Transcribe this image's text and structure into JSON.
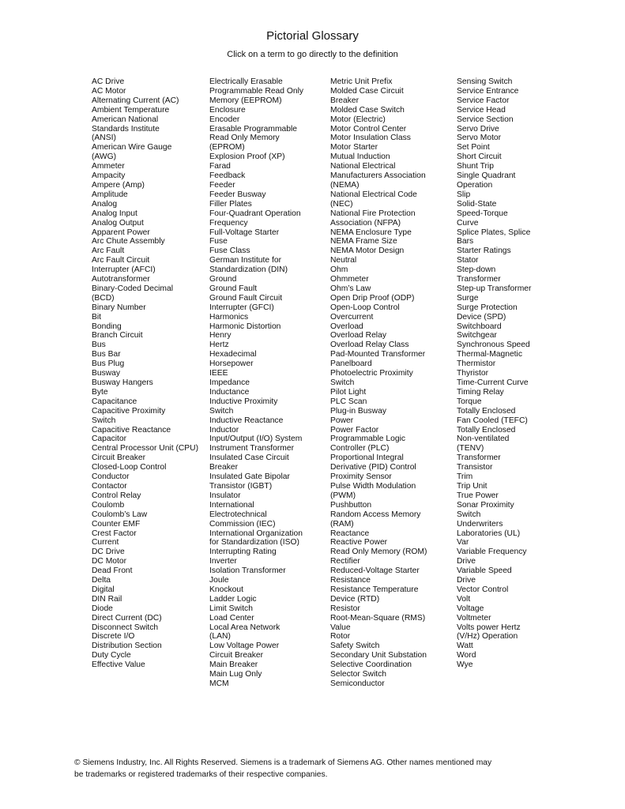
{
  "header": {
    "title": "Pictorial Glossary",
    "subtitle": "Click on a term to go directly to the definition"
  },
  "columns": [
    [
      "AC Drive",
      "AC Motor",
      "Alternating Current (AC)",
      "Ambient Temperature",
      "American National",
      "Standards Institute",
      "(ANSI)",
      "American Wire Gauge",
      "(AWG)",
      "Ammeter",
      "Ampacity",
      "Ampere (Amp)",
      "Amplitude",
      "Analog",
      "Analog Input",
      "Analog Output",
      "Apparent Power",
      "Arc Chute Assembly",
      "Arc Fault",
      "Arc Fault Circuit",
      "Interrupter (AFCI)",
      "Autotransformer",
      "Binary-Coded Decimal",
      "(BCD)",
      "Binary Number",
      "Bit",
      "Bonding",
      "Branch Circuit",
      "Bus",
      "Bus Bar",
      "Bus Plug",
      "Busway",
      "Busway Hangers",
      "Byte",
      "Capacitance",
      "Capacitive Proximity",
      "Switch",
      "Capacitive Reactance",
      "Capacitor",
      "Central Processor Unit (CPU)",
      "Circuit Breaker",
      "Closed-Loop Control",
      "Conductor",
      "Contactor",
      "Control Relay",
      "Coulomb",
      "Coulomb’s Law",
      "Counter EMF",
      "Crest Factor",
      "Current",
      "DC Drive",
      "DC Motor",
      "Dead Front",
      "Delta",
      "Digital",
      "DIN Rail",
      "Diode",
      "Direct Current (DC)",
      "Disconnect Switch",
      "Discrete I/O",
      "Distribution Section",
      "Duty Cycle",
      "Effective Value"
    ],
    [
      "Electrically Erasable",
      "Programmable Read Only",
      "Memory (EEPROM)",
      "Enclosure",
      "Encoder",
      "Erasable Programmable",
      "Read Only Memory",
      "(EPROM)",
      "Explosion Proof (XP)",
      "Farad",
      "Feedback",
      "Feeder",
      "Feeder Busway",
      "Filler Plates",
      "Four-Quadrant Operation",
      "Frequency",
      "Full-Voltage Starter",
      "Fuse",
      "Fuse Class",
      "German Institute for",
      "Standardization (DIN)",
      "Ground",
      "Ground Fault",
      "Ground Fault Circuit",
      "Interrupter (GFCI)",
      "Harmonics",
      "Harmonic Distortion",
      "Henry",
      "Hertz",
      "Hexadecimal",
      "Horsepower",
      "IEEE",
      "Impedance",
      "Inductance",
      "Inductive Proximity",
      "Switch",
      "Inductive Reactance",
      "Inductor",
      "Input/Output (I/O) System",
      "Instrument Transformer",
      "Insulated Case Circuit",
      "Breaker",
      "Insulated Gate Bipolar",
      "Transistor (IGBT)",
      "Insulator",
      "International",
      "Electrotechnical",
      "Commission (IEC)",
      "International Organization",
      "for Standardization (ISO)",
      "Interrupting Rating",
      "Inverter",
      "Isolation Transformer",
      "Joule",
      "Knockout",
      "Ladder Logic",
      "Limit Switch",
      "Load Center",
      "Local Area Network",
      "(LAN)",
      "Low Voltage Power",
      "Circuit Breaker",
      "Main Breaker",
      "Main Lug Only",
      "MCM"
    ],
    [
      "Metric Unit Prefix",
      "Molded Case Circuit",
      "Breaker",
      "Molded Case Switch",
      "Motor (Electric)",
      "Motor Control Center",
      "Motor Insulation Class",
      "Motor Starter",
      "Mutual Induction",
      "National Electrical",
      "Manufacturers Association",
      "(NEMA)",
      "National Electrical Code",
      "(NEC)",
      "National Fire Protection",
      "Association (NFPA)",
      "NEMA Enclosure Type",
      "NEMA Frame Size",
      "NEMA Motor Design",
      "Neutral",
      "Ohm",
      "Ohmmeter",
      "Ohm’s Law",
      "Open Drip Proof (ODP)",
      "Open-Loop Control",
      "Overcurrent",
      "Overload",
      "Overload Relay",
      "Overload Relay Class",
      "Pad-Mounted Transformer",
      "Panelboard",
      "Photoelectric Proximity",
      "Switch",
      "Pilot Light",
      "PLC Scan",
      "Plug-in Busway",
      "Power",
      "Power Factor",
      "Programmable Logic",
      "Controller (PLC)",
      "Proportional Integral",
      "Derivative (PID) Control",
      "Proximity Sensor",
      "Pulse Width Modulation",
      "(PWM)",
      "Pushbutton",
      "Random Access Memory",
      "(RAM)",
      "Reactance",
      "Reactive Power",
      "Read Only Memory (ROM)",
      "Rectifier",
      "Reduced-Voltage Starter",
      "Resistance",
      "Resistance Temperature",
      "Device (RTD)",
      "Resistor",
      "Root-Mean-Square (RMS)",
      "Value",
      "Rotor",
      "Safety Switch",
      "Secondary Unit Substation",
      "Selective Coordination",
      "Selector Switch",
      "Semiconductor"
    ],
    [
      "Sensing Switch",
      "Service Entrance",
      "Service Factor",
      "Service Head",
      "Service Section",
      "Servo Drive",
      "Servo Motor",
      "Set Point",
      "Short Circuit",
      "Shunt Trip",
      "Single Quadrant",
      "Operation",
      "Slip",
      "Solid-State",
      "Speed-Torque",
      "Curve",
      "Splice Plates, Splice",
      "Bars",
      "Starter Ratings",
      "Stator",
      "Step-down",
      "Transformer",
      "Step-up Transformer",
      "Surge",
      "Surge Protection",
      "Device (SPD)",
      "Switchboard",
      "Switchgear",
      "Synchronous Speed",
      "Thermal-Magnetic",
      "Thermistor",
      "Thyristor",
      "Time-Current Curve",
      "Timing Relay",
      "Torque",
      "Totally Enclosed",
      "Fan Cooled (TEFC)",
      "Totally Enclosed",
      "Non-ventilated",
      "(TENV)",
      "Transformer",
      "Transistor",
      "Trim",
      "Trip Unit",
      "True Power",
      "Sonar Proximity",
      "Switch",
      "Underwriters",
      "Laboratories (UL)",
      "Var",
      "Variable Frequency",
      "Drive",
      "Variable Speed",
      "Drive",
      "Vector Control",
      "Volt",
      "Voltage",
      "Voltmeter",
      "Volts power Hertz",
      "(V/Hz) Operation",
      "Watt",
      "Word",
      "Wye"
    ]
  ],
  "footer": {
    "line1": "© Siemens Industry, Inc. All Rights Reserved. Siemens is a trademark of Siemens AG. Other names mentioned may",
    "line2": "be trademarks or registered trademarks of their respective companies."
  }
}
